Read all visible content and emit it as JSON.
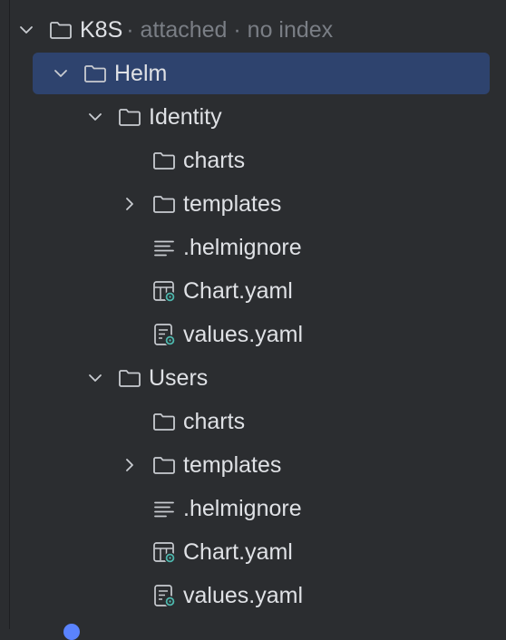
{
  "tree": {
    "root": {
      "label": "K8S",
      "meta": "· attached · no index"
    },
    "helm": {
      "label": "Helm"
    },
    "identity": {
      "label": "Identity",
      "charts": "charts",
      "templates": "templates",
      "helmignore": ".helmignore",
      "chart_yaml": "Chart.yaml",
      "values_yaml": "values.yaml"
    },
    "users": {
      "label": "Users",
      "charts": "charts",
      "templates": "templates",
      "helmignore": ".helmignore",
      "chart_yaml": "Chart.yaml",
      "values_yaml": "values.yaml"
    }
  },
  "colors": {
    "background": "#2b2d30",
    "selection": "#2e436e",
    "text": "#dfe1e5",
    "muted": "#7a7e85",
    "yaml_accent": "#4db6ac"
  },
  "icons": {
    "folder": "folder-icon",
    "text": "text-file-icon",
    "chart": "chart-yaml-icon",
    "values": "values-yaml-icon",
    "expand": "chevron-down-icon",
    "collapse": "chevron-right-icon"
  }
}
